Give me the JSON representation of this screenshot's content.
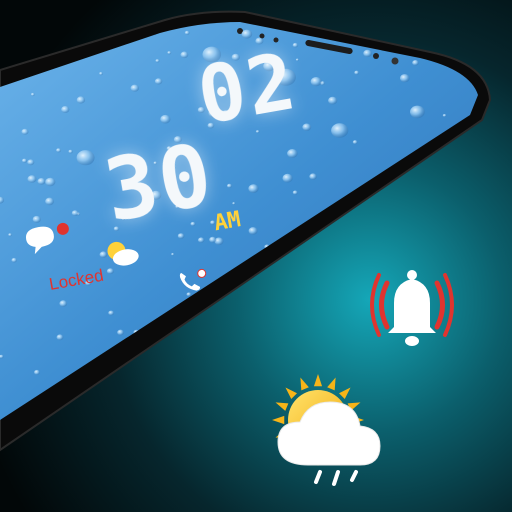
{
  "lockscreen": {
    "hours": "02",
    "minutes": "30",
    "ampm": "AM",
    "status_text": "Locked"
  },
  "colors": {
    "screen": "#4d9bd8",
    "accent": "#ffd23a",
    "alert": "#e0342f",
    "frame": "#0a0a0a"
  },
  "icons": {
    "notification": "bell-icon",
    "weather": "partly-cloudy-rain-icon",
    "phone": "phone-icon",
    "message": "message-icon"
  }
}
